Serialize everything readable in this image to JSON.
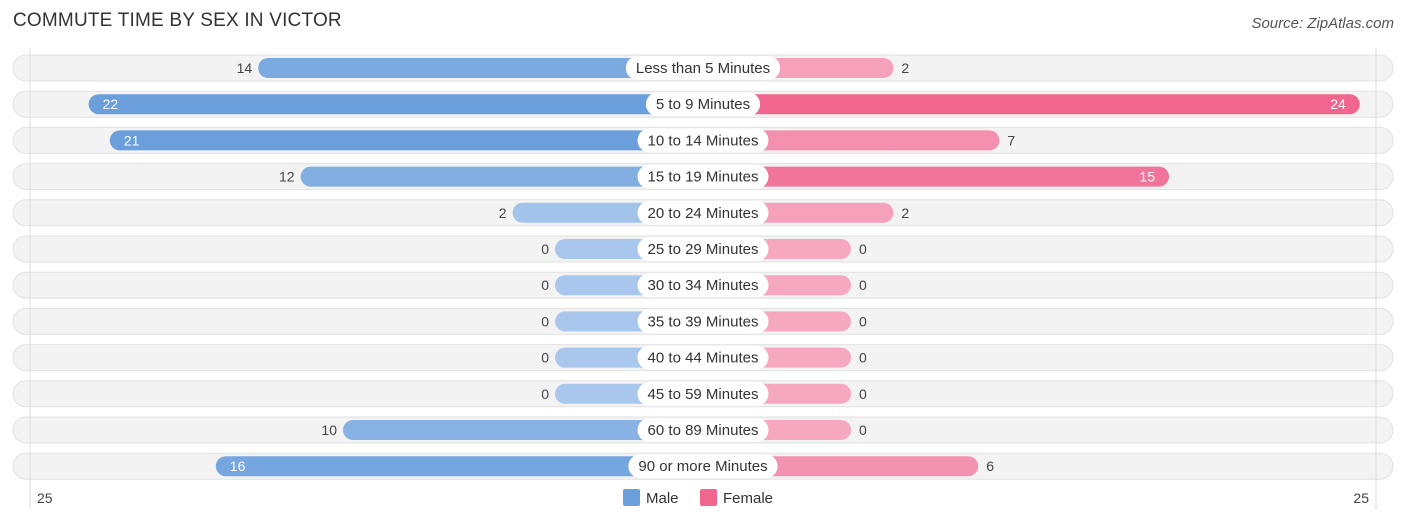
{
  "header": {
    "title": "COMMUTE TIME BY SEX IN VICTOR",
    "source": "Source: ZipAtlas.com"
  },
  "colors": {
    "male": "#6a9fdc",
    "male_light": "#a9c7ec",
    "female": "#f0668f",
    "female_light": "#f6a8c1",
    "row_bg": "#f3f3f3"
  },
  "chart_data": {
    "type": "bar",
    "orientation": "horizontal-diverging",
    "title": "COMMUTE TIME BY SEX IN VICTOR",
    "categories": [
      "Less than 5 Minutes",
      "5 to 9 Minutes",
      "10 to 14 Minutes",
      "15 to 19 Minutes",
      "20 to 24 Minutes",
      "25 to 29 Minutes",
      "30 to 34 Minutes",
      "35 to 39 Minutes",
      "40 to 44 Minutes",
      "45 to 59 Minutes",
      "60 to 89 Minutes",
      "90 or more Minutes"
    ],
    "series": [
      {
        "name": "Male",
        "side": "left",
        "values": [
          14,
          22,
          21,
          12,
          2,
          0,
          0,
          0,
          0,
          0,
          10,
          16
        ]
      },
      {
        "name": "Female",
        "side": "right",
        "values": [
          2,
          24,
          7,
          15,
          2,
          0,
          0,
          0,
          0,
          0,
          0,
          6
        ]
      }
    ],
    "axis": {
      "left_tick": "25",
      "right_tick": "25",
      "max": 25
    },
    "legend": {
      "position": "bottom-center",
      "entries": [
        "Male",
        "Female"
      ]
    }
  }
}
